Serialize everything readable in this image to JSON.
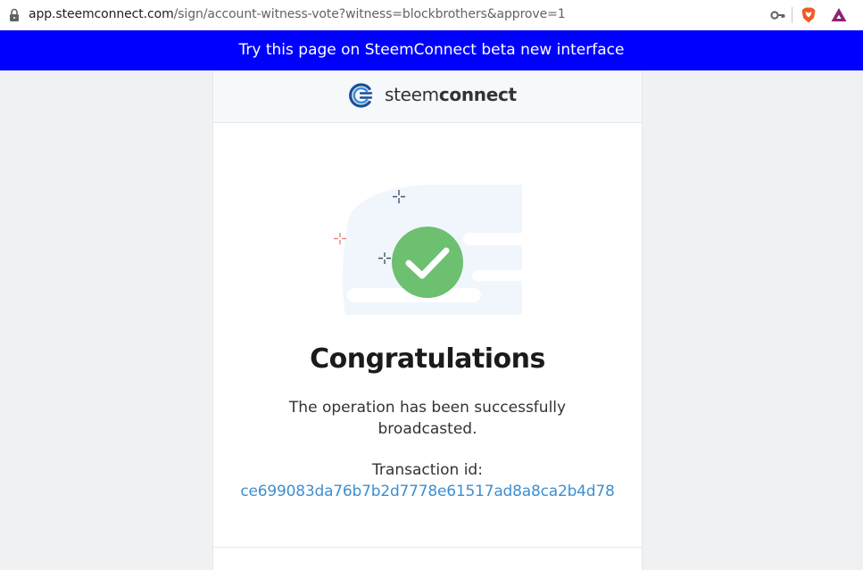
{
  "browser": {
    "url_host": "app.steemconnect.com",
    "url_path": "/sign/account-witness-vote?witness=blockbrothers&approve=1",
    "icons": [
      "lock-icon",
      "key-icon",
      "brave-shields-icon",
      "brave-rewards-icon"
    ]
  },
  "banner": {
    "text": "Try this page on SteemConnect beta new interface"
  },
  "header": {
    "logo_light": "steem",
    "logo_bold": "connect"
  },
  "result": {
    "title": "Congratulations",
    "message": "The operation has been successfully broadcasted.",
    "tx_label": "Transaction id:",
    "tx_id": "ce699083da76b7b2d7778e61517ad8a8ca2b4d78"
  },
  "colors": {
    "banner": "#0000ff",
    "success": "#6cc070",
    "link": "#3d8fd1",
    "brand": "#1a5099"
  }
}
